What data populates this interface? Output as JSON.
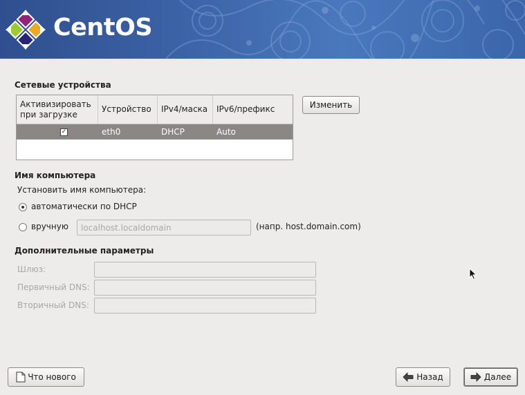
{
  "header": {
    "brand": "CentOS",
    "logo_icon": "centos-logo-icon"
  },
  "network_devices": {
    "title": "Сетевые устройства",
    "columns": [
      "Активизировать при загрузке",
      "Устройство",
      "IPv4/маска",
      "IPv6/префикс"
    ],
    "rows": [
      {
        "active": true,
        "device": "eth0",
        "ipv4": "DHCP",
        "ipv6": "Auto"
      }
    ],
    "edit_button": "Изменить"
  },
  "hostname": {
    "title": "Имя компьютера",
    "prompt": "Установить имя компьютера:",
    "option_auto": "автоматически по DHCP",
    "option_manual": "вручную",
    "manual_value": "localhost.localdomain",
    "example": "(напр. host.domain.com)",
    "selected": "auto"
  },
  "advanced": {
    "title": "Дополнительные параметры",
    "gateway_label": "Шлюз:",
    "dns1_label": "Первичный DNS:",
    "dns2_label": "Вторичный DNS:"
  },
  "footer": {
    "release_notes": "Что нового",
    "back": "Назад",
    "next": "Далее"
  },
  "colors": {
    "banner": "#3c63a6",
    "selected_row": "#8a8784",
    "background": "#edeceb"
  }
}
